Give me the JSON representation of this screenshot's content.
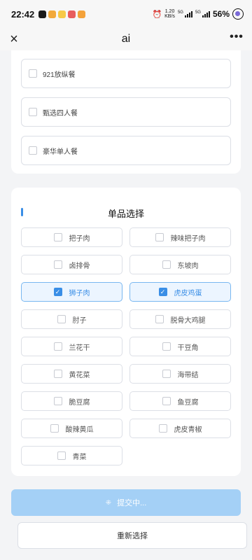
{
  "status": {
    "time": "22:42",
    "net_speed_value": "1.20",
    "net_speed_unit": "KB/s",
    "sim1_tag": "5G",
    "sim2_tag": "5G",
    "battery": "56%",
    "app_icon_colors": [
      "#1a1a1a",
      "#f2a93b",
      "#f7c948",
      "#e85d5d",
      "#f4a23a"
    ]
  },
  "nav": {
    "title": "ai",
    "close_icon": "×",
    "more_icon": "•••"
  },
  "combos": [
    {
      "label": "921放纵餐",
      "checked": false
    },
    {
      "label": "甄选四人餐",
      "checked": false
    },
    {
      "label": "豪华单人餐",
      "checked": false
    }
  ],
  "single": {
    "title": "单品选择",
    "items": [
      {
        "label": "把子肉",
        "checked": false
      },
      {
        "label": "辣味把子肉",
        "checked": false
      },
      {
        "label": "卤排骨",
        "checked": false
      },
      {
        "label": "东坡肉",
        "checked": false
      },
      {
        "label": "狮子肉",
        "checked": true
      },
      {
        "label": "虎皮鸡蛋",
        "checked": true
      },
      {
        "label": "肘子",
        "checked": false
      },
      {
        "label": "脱骨大鸡腿",
        "checked": false
      },
      {
        "label": "兰花干",
        "checked": false
      },
      {
        "label": "干豆角",
        "checked": false
      },
      {
        "label": "黄花菜",
        "checked": false
      },
      {
        "label": "海带结",
        "checked": false
      },
      {
        "label": "脆豆腐",
        "checked": false
      },
      {
        "label": "鱼豆腐",
        "checked": false
      },
      {
        "label": "酸辣黄瓜",
        "checked": false
      },
      {
        "label": "虎皮青椒",
        "checked": false
      },
      {
        "label": "青菜",
        "checked": false
      }
    ]
  },
  "actions": {
    "submit_label": "提交中...",
    "spinner_icon": "⁜",
    "reset_label": "重新选择"
  },
  "colors": {
    "accent": "#3a8ee6",
    "submit_bg": "#a4d0f6",
    "selected_bg": "#ecf5ff"
  }
}
